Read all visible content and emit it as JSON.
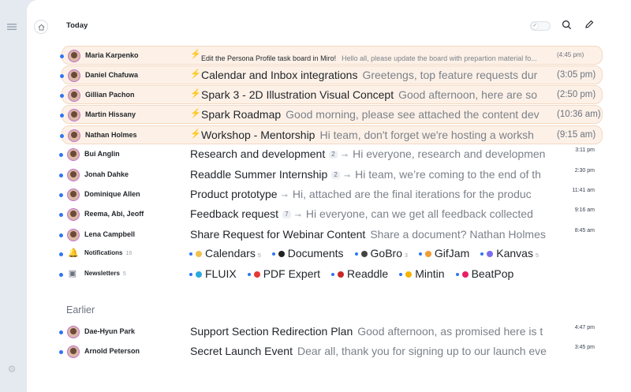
{
  "header": {
    "section_title": "Today",
    "earlier_title": "Earlier"
  },
  "icons": [
    "menu-icon",
    "home-icon",
    "toggle-icon",
    "search-icon",
    "compose-icon",
    "settings-icon",
    "bolt-icon",
    "paperclip-icon",
    "bell-icon",
    "newsletter-icon"
  ],
  "emails": [
    {
      "sender": "Maria Karpenko",
      "subject": "Edit the Persona Profile task board in Miro!",
      "preview": "Hello all, please update the board with prepartion material fo...",
      "time": "(4:45 pm)",
      "priority": true
    },
    {
      "sender": "Daniel Chafuwa",
      "subject": "Calendar and Inbox integrations",
      "preview": "Greetengs, top feature requests dur",
      "time": "(3:05 pm)",
      "priority": true
    },
    {
      "sender": "Gillian Pachon",
      "subject": "Spark 3 - 2D Illustration Visual Concept",
      "preview": "Good afternoon, here are so",
      "time": "(2:50 pm)",
      "priority": true
    },
    {
      "sender": "Martin Hissany",
      "subject": "Spark Roadmap",
      "preview": "Good morning, please see attached the content dev",
      "time": "(10:36 am)",
      "priority": true
    },
    {
      "sender": "Nathan Holmes",
      "subject": "Workshop - Mentorship",
      "preview": "Hi team, don't forget we're hosting a worksh",
      "time": "(9:15 am)",
      "priority": true
    },
    {
      "sender": "Bui Anglin",
      "subject": "Research and development",
      "count": "2",
      "attach": true,
      "preview": "Hi everyone, research and developmen",
      "time": "3:11 pm"
    },
    {
      "sender": "Jonah Dahke",
      "subject": "Readdle Summer Internship",
      "count": "2",
      "attach": true,
      "preview": "Hi team, we’re coming to the end of th",
      "time": "2:30 pm"
    },
    {
      "sender": "Dominique Allen",
      "subject": "Product prototype",
      "attach": true,
      "preview": "Hi, attached are the final iterations for the produc",
      "time": "11:41 am"
    },
    {
      "sender": "Reema, Abi, Jeoff",
      "subject": "Feedback request",
      "count": "7",
      "attach": true,
      "preview": "Hi everyone, can we get all feedback collected",
      "time": "9:16 am"
    },
    {
      "sender": "Lena Campbell",
      "subject": "Share Request for Webinar Content",
      "preview": "Share a document? Nathan Holmes",
      "time": "8:45 am"
    }
  ],
  "notifications": {
    "label": "Notifications",
    "count": "16",
    "chips": [
      {
        "name": "Calendars",
        "count": "5",
        "color": "#f2c14e"
      },
      {
        "name": "Documents",
        "count": "",
        "color": "#222222"
      },
      {
        "name": "GoBro",
        "count": "3",
        "color": "#444444"
      },
      {
        "name": "GifJam",
        "count": "",
        "color": "#f39c32"
      },
      {
        "name": "Kanvas",
        "count": "5",
        "color": "#7c6cf0"
      }
    ]
  },
  "newsletters": {
    "label": "Newsletters",
    "count": "5",
    "chips": [
      {
        "name": "FLUIX",
        "color": "#2aa9e0"
      },
      {
        "name": "PDF Expert",
        "color": "#e53935"
      },
      {
        "name": "Readdle",
        "color": "#c62828"
      },
      {
        "name": "Mintin",
        "color": "#f5b400"
      },
      {
        "name": "BeatPop",
        "color": "#e91e63"
      }
    ]
  },
  "earlier": [
    {
      "sender": "Dae-Hyun Park",
      "subject": "Support Section Redirection Plan",
      "preview": "Good afternoon, as promised here is t",
      "time": "4:47 pm"
    },
    {
      "sender": "Arnold Peterson",
      "subject": "Secret Launch Event",
      "preview": "Dear all, thank you for signing up to our launch eve",
      "time": "3:45 pm"
    }
  ]
}
